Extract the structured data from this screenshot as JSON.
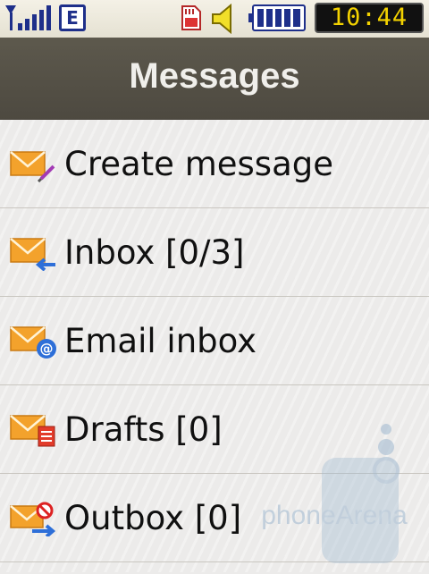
{
  "status_bar": {
    "signal_icon": "signal-strength-icon",
    "network_label": "E",
    "sd_icon": "sd-card-icon",
    "sound_icon": "speaker-icon",
    "battery_icon": "battery-icon",
    "battery_level": 1.0,
    "time": "10:44"
  },
  "header": {
    "title": "Messages"
  },
  "menu": {
    "items": [
      {
        "label": "Create message",
        "icon": "envelope-pen-icon"
      },
      {
        "label": "Inbox [0/3]",
        "icon": "envelope-inbox-icon"
      },
      {
        "label": "Email inbox",
        "icon": "envelope-at-icon"
      },
      {
        "label": "Drafts [0]",
        "icon": "envelope-drafts-icon"
      },
      {
        "label": "Outbox [0]",
        "icon": "envelope-outbox-icon"
      }
    ]
  },
  "watermark": {
    "text": "phoneArena"
  },
  "colors": {
    "envelope": "#f3a22c",
    "header": "#545046",
    "clock_text": "#f3d200"
  }
}
